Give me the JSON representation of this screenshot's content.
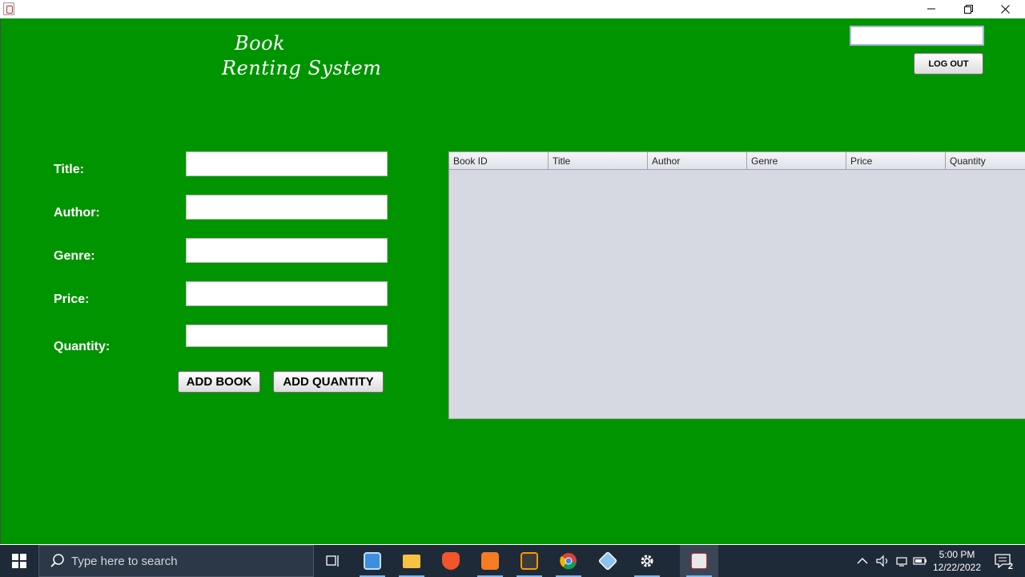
{
  "window": {
    "title_icon": "java-icon"
  },
  "app": {
    "brand_line1": "Book",
    "brand_line2": "Renting System",
    "user_field_value": "",
    "logout_label": "LOG OUT",
    "form": {
      "title_label": "Title:",
      "author_label": "Author:",
      "genre_label": "Genre:",
      "price_label": "Price:",
      "quantity_label": "Quantity:",
      "title_value": "",
      "author_value": "",
      "genre_value": "",
      "price_value": "",
      "quantity_value": ""
    },
    "add_book_label": "ADD BOOK",
    "add_quantity_label": "ADD QUANTITY",
    "table": {
      "columns": [
        "Book ID",
        "Title",
        "Author",
        "Genre",
        "Price",
        "Quantity"
      ],
      "rows": []
    }
  },
  "taskbar": {
    "search_placeholder": "Type here to search",
    "time": "5:00 PM",
    "date": "12/22/2022",
    "notification_count": "2"
  },
  "colors": {
    "app_background": "#009400",
    "table_background": "#d6d9e1",
    "taskbar_background": "#1f2a38"
  }
}
